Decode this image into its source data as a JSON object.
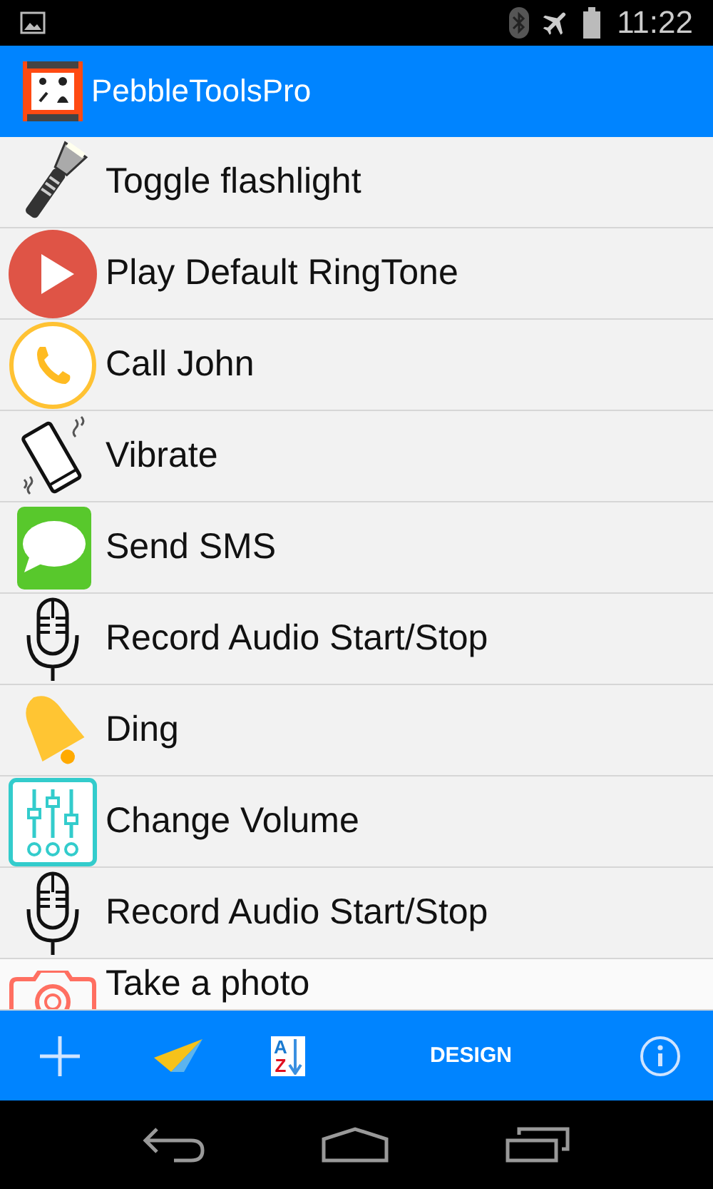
{
  "status_bar": {
    "time": "11:22"
  },
  "app_bar": {
    "title": "PebbleToolsPro"
  },
  "actions": [
    {
      "kind": "flashlight",
      "label": "Toggle flashlight"
    },
    {
      "kind": "play",
      "label": "Play Default RingTone"
    },
    {
      "kind": "call",
      "label": "Call John"
    },
    {
      "kind": "vibrate",
      "label": "Vibrate"
    },
    {
      "kind": "sms",
      "label": "Send SMS"
    },
    {
      "kind": "mic",
      "label": "Record Audio Start/Stop"
    },
    {
      "kind": "bell",
      "label": "Ding"
    },
    {
      "kind": "volume",
      "label": "Change Volume"
    },
    {
      "kind": "mic",
      "label": "Record Audio Start/Stop"
    },
    {
      "kind": "camera",
      "label": "Take a photo"
    }
  ],
  "bottom_bar": {
    "sort_letters": [
      "A",
      "Z"
    ],
    "design_label": "DESIGN"
  }
}
